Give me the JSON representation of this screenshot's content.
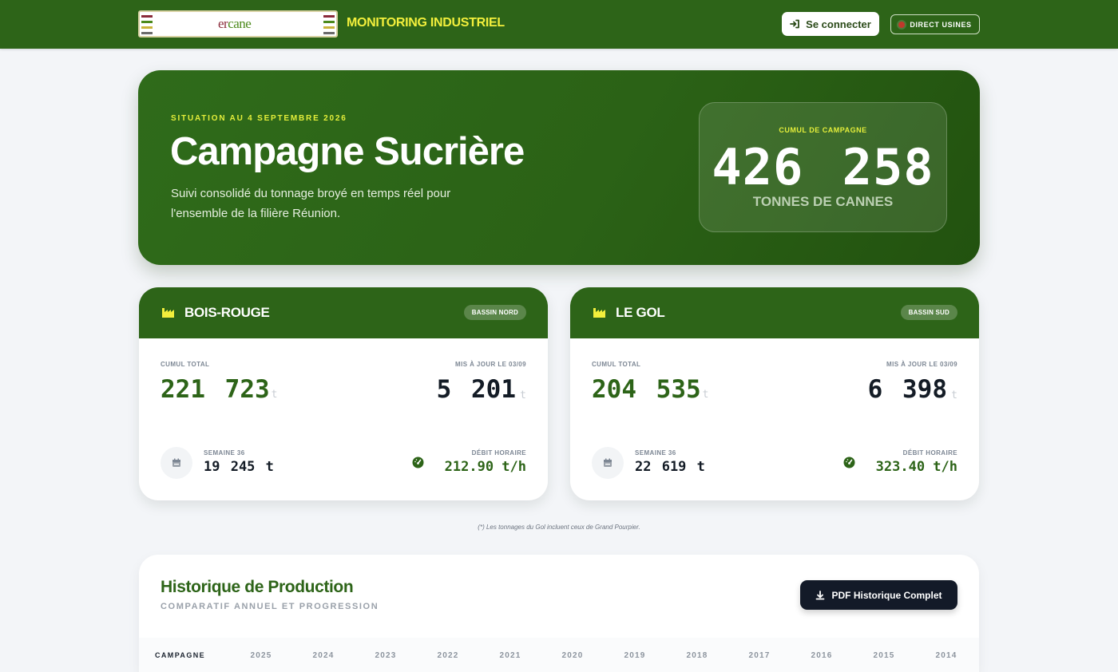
{
  "header": {
    "logo_text_a": "er",
    "logo_text_b": "cane",
    "app_title": "MONITORING INDUSTRIEL",
    "login_label": "Se connecter",
    "direct_label": "DIRECT USINES"
  },
  "hero": {
    "kicker": "SITUATION AU 4 SEPTEMBRE 2026",
    "title": "Campagne Sucrière",
    "subtitle": "Suivi consolidé du tonnage broyé en temps réel pour l'ensemble de la filière Réunion.",
    "total_label": "CUMUL DE CAMPAGNE",
    "total_value": "426 258",
    "total_unit": "TONNES DE CANNES"
  },
  "factories": [
    {
      "name": "BOIS-ROUGE",
      "basin": "BASSIN NORD",
      "cumul_label": "CUMUL TOTAL",
      "cumul_value": "221 723",
      "update_label": "MIS À JOUR LE 03/09",
      "update_value": "5 201",
      "unit": "t",
      "week_label": "SEMAINE 36",
      "week_value": "19 245 t",
      "rate_label": "DÉBIT HORAIRE",
      "rate_value": "212.90 t/h"
    },
    {
      "name": "LE GOL",
      "basin": "BASSIN SUD",
      "cumul_label": "CUMUL TOTAL",
      "cumul_value": "204 535",
      "update_label": "MIS À JOUR LE 03/09",
      "update_value": "6 398",
      "unit": "t",
      "week_label": "SEMAINE 36",
      "week_value": "22 619 t",
      "rate_label": "DÉBIT HORAIRE",
      "rate_value": "323.40 t/h"
    }
  ],
  "footnote": "(*) Les tonnages du Gol incluent ceux de Grand Pourpier.",
  "history": {
    "title": "Historique de Production",
    "subtitle": "COMPARATIF ANNUEL ET PROGRESSION",
    "pdf_label": "PDF Historique Complet",
    "columns": [
      "CAMPAGNE",
      "2025",
      "2024",
      "2023",
      "2022",
      "2021",
      "2020",
      "2019",
      "2018",
      "2017",
      "2016",
      "2015",
      "2014"
    ]
  },
  "colors": {
    "primary_green": "#2d6418",
    "accent_yellow": "#e4ee3a",
    "dark": "#131a28"
  },
  "icons": {
    "login": "sign-in-icon",
    "live": "live-dot-icon",
    "factory": "factory-icon",
    "calendar": "calendar-icon",
    "gauge": "gauge-icon",
    "download": "download-icon"
  }
}
